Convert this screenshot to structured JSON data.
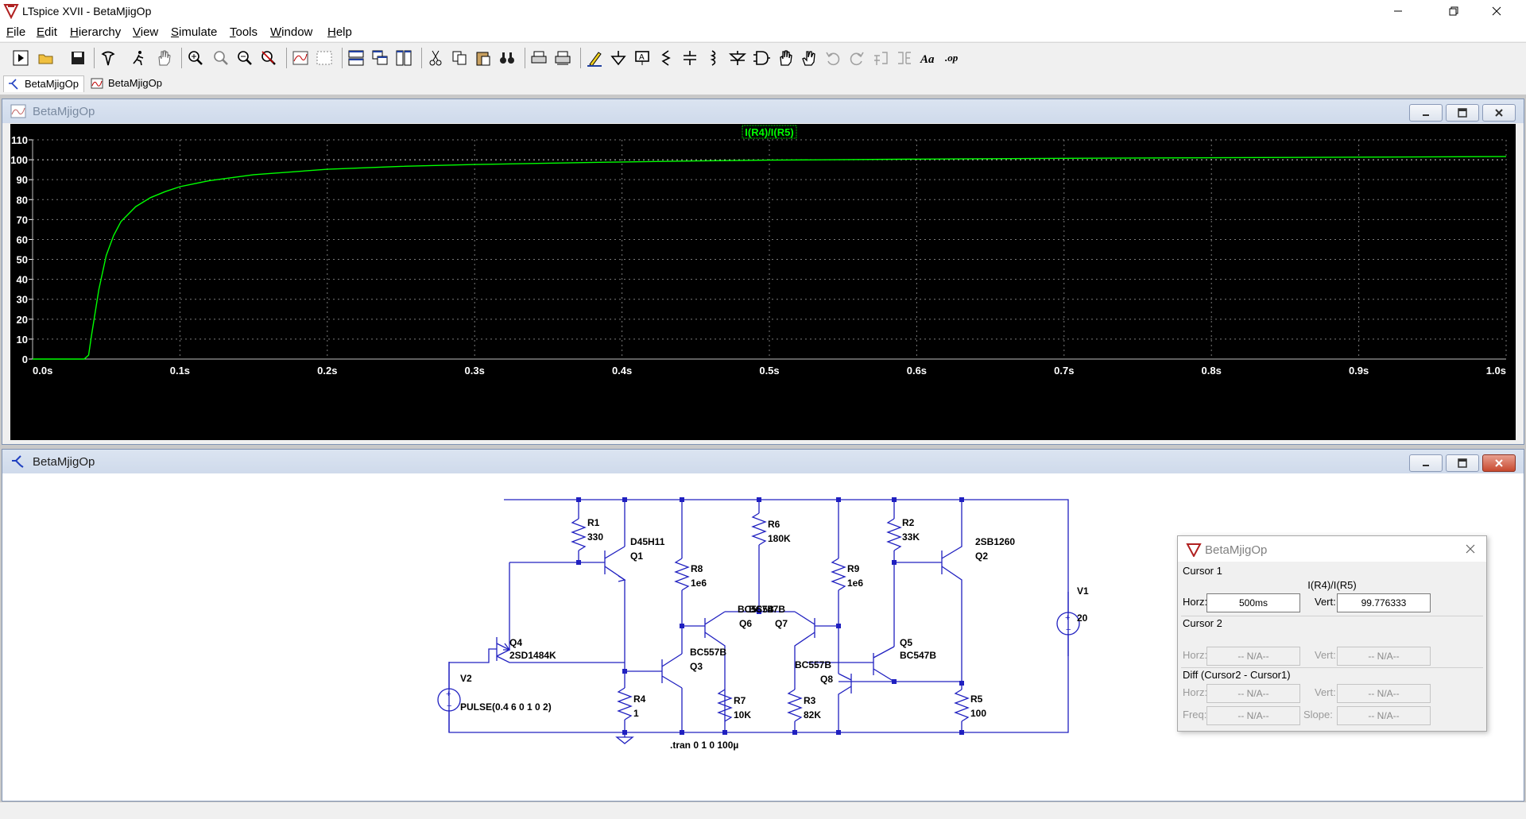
{
  "window": {
    "title": "LTspice XVII - BetaMjigOp"
  },
  "menu": [
    {
      "label": "File",
      "hotkey": "F",
      "rest": "ile"
    },
    {
      "label": "Edit",
      "hotkey": "E",
      "rest": "dit"
    },
    {
      "label": "Hierarchy",
      "hotkey": "H",
      "rest": "ierarchy"
    },
    {
      "label": "View",
      "hotkey": "V",
      "rest": "iew"
    },
    {
      "label": "Simulate",
      "hotkey": "S",
      "rest": "imulate"
    },
    {
      "label": "Tools",
      "hotkey": "T",
      "rest": "ools"
    },
    {
      "label": "Window",
      "hotkey": "W",
      "rest": "indow"
    },
    {
      "label": "Help",
      "hotkey": "H",
      "rest": "elp"
    }
  ],
  "tabs": [
    {
      "label": "BetaMjigOp",
      "icon": "schematic-icon",
      "active": true
    },
    {
      "label": "BetaMjigOp",
      "icon": "waveform-icon",
      "active": false
    }
  ],
  "plot_window": {
    "title": "BetaMjigOp"
  },
  "schematic_window": {
    "title": "BetaMjigOp"
  },
  "chart_data": {
    "type": "line",
    "title": "",
    "series": [
      {
        "name": "I(R4)/I(R5)",
        "color": "#00ff00",
        "x": [
          0.0,
          0.035,
          0.038,
          0.04,
          0.045,
          0.05,
          0.055,
          0.06,
          0.07,
          0.08,
          0.09,
          0.1,
          0.12,
          0.15,
          0.2,
          0.25,
          0.3,
          0.35,
          0.4,
          0.45,
          0.5,
          0.6,
          0.7,
          0.8,
          0.9,
          1.0
        ],
        "y": [
          0,
          0,
          2,
          12,
          35,
          52,
          62,
          69,
          76.5,
          81,
          84,
          86.5,
          89.5,
          92.5,
          95.2,
          96.7,
          97.6,
          98.3,
          98.9,
          99.4,
          99.8,
          100.3,
          100.7,
          101.0,
          101.3,
          101.6
        ]
      }
    ],
    "xlim": [
      0,
      1.0
    ],
    "ylim": [
      0,
      110
    ],
    "x_ticks": [
      "0.0s",
      "0.1s",
      "0.2s",
      "0.3s",
      "0.4s",
      "0.5s",
      "0.6s",
      "0.7s",
      "0.8s",
      "0.9s",
      "1.0s"
    ],
    "x_tick_values": [
      0,
      0.1,
      0.2,
      0.3,
      0.4,
      0.5,
      0.6,
      0.7,
      0.8,
      0.9,
      1.0
    ],
    "y_ticks": [
      "0",
      "10",
      "20",
      "30",
      "40",
      "50",
      "60",
      "70",
      "80",
      "90",
      "100",
      "110"
    ],
    "y_tick_values": [
      0,
      10,
      20,
      30,
      40,
      50,
      60,
      70,
      80,
      90,
      100,
      110
    ],
    "grid": true,
    "background": "#000000",
    "reference_line_y": 100,
    "cursor_x": 0.5
  },
  "schematic": {
    "color": "#2020c0",
    "labels": {
      "r1_name": "R1",
      "r1_val": "330",
      "r2_name": "R2",
      "r2_val": "33K",
      "r3_name": "R3",
      "r3_val": "82K",
      "r4_name": "R4",
      "r4_val": "1",
      "r5_name": "R5",
      "r5_val": "100",
      "r6_name": "R6",
      "r6_val": "180K",
      "r7_name": "R7",
      "r7_val": "10K",
      "r8_name": "R8",
      "r8_val": "1e6",
      "r9_name": "R9",
      "r9_val": "1e6",
      "q1_model": "D45H11",
      "q1_name": "Q1",
      "q2_model": "2SB1260",
      "q2_name": "Q2",
      "q3_model": "BC557B",
      "q3_name": "Q3",
      "q4_name": "Q4",
      "q4_model": "2SD1484K",
      "q5_name": "Q5",
      "q5_model": "BC547B",
      "q6_model": "BC557B",
      "q6_name": "Q6",
      "q7_model": "BC547B",
      "q7_name": "Q7",
      "q8_model": "BC557B",
      "q8_name": "Q8",
      "v1_name": "V1",
      "v1_val": "20",
      "v2_name": "V2",
      "v2_val": "PULSE(0.4 6 0 1 0 2)",
      "directive": ".tran 0 1 0 100µ"
    }
  },
  "cursor_dialog": {
    "title": "BetaMjigOp",
    "cursor1_label": "Cursor 1",
    "trace_name": "I(R4)/I(R5)",
    "horz_label": "Horz:",
    "vert_label": "Vert:",
    "c1_horz": "500ms",
    "c1_vert": "99.776333",
    "cursor2_label": "Cursor 2",
    "c2_horz": "-- N/A--",
    "c2_vert": "-- N/A--",
    "diff_label": "Diff (Cursor2 - Cursor1)",
    "d_horz": "-- N/A--",
    "d_vert": "-- N/A--",
    "freq_label": "Freq:",
    "slope_label": "Slope:",
    "d_freq": "-- N/A--",
    "d_slope": "-- N/A--"
  },
  "toolbar": [
    "run-icon",
    "open-icon",
    "save-icon",
    "control-panel-icon",
    "run-man-icon",
    "pan-hand-icon",
    "zoom-in-icon",
    "zoom-out-icon",
    "zoom-full-icon",
    "zoom-cancel-icon",
    "autorange-icon",
    "grid-icon",
    "tile-horizontal-icon",
    "cascade-icon",
    "tile-vertical-icon",
    "cut-icon",
    "copy-icon",
    "paste-icon",
    "find-icon",
    "print-icon",
    "print-setup-icon",
    "draw-wire-icon",
    "ground-icon",
    "label-net-icon",
    "resistor-icon",
    "capacitor-icon",
    "inductor-icon",
    "diode-icon",
    "component-icon",
    "move-icon",
    "drag-icon",
    "undo-icon",
    "redo-icon",
    "rotate-icon",
    "mirror-icon",
    "text-icon",
    "spice-directive-icon"
  ]
}
